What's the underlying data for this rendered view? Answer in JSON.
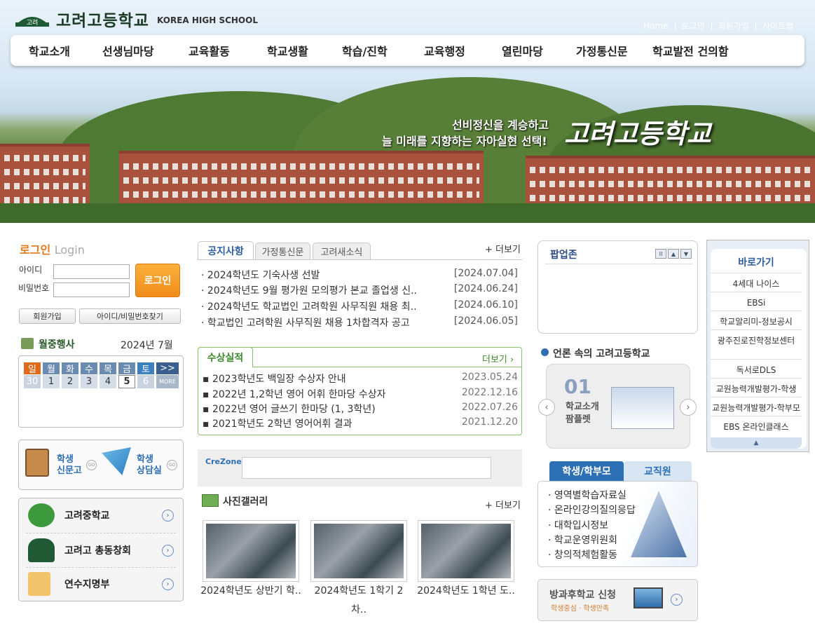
{
  "header": {
    "school_name": "고려고등학교",
    "school_name_en": "KOREA HIGH SCHOOL",
    "logo_mark": "고려",
    "util_links": [
      "Home",
      "로그인",
      "회원가입",
      "사이트맵"
    ],
    "nav": [
      "학교소개",
      "선생님마당",
      "교육활동",
      "학교생활",
      "학습/진학",
      "교육행정",
      "열린마당",
      "가정통신문",
      "학교발전 건의함"
    ],
    "slogan_line1": "선비정신을 계승하고",
    "slogan_line2": "늘 미래를 지향하는 자아실현 선택!",
    "slogan_name": "고려고등학교"
  },
  "login": {
    "title": "로그인",
    "title_en": "Login",
    "id_label": "아이디",
    "pw_label": "비밀번호",
    "button": "로그인",
    "join": "회원가입",
    "find": "아이디/비밀번호찾기"
  },
  "calendar": {
    "title": "월중행사",
    "date": "2024년 7월",
    "weekdays": [
      "일",
      "월",
      "화",
      "수",
      "목",
      "금",
      "토"
    ],
    "more": ">>",
    "more_sub": "MORE",
    "days": [
      "30",
      "1",
      "2",
      "3",
      "4",
      "5",
      "6"
    ]
  },
  "quick_left": {
    "newspaper": "학생 신문고",
    "counsel": "학생 상담실",
    "go": "GO"
  },
  "family": [
    {
      "label": "고려중학교"
    },
    {
      "label": "고려고 총동창회"
    },
    {
      "label": "연수지명부"
    }
  ],
  "notice": {
    "tabs": [
      "공지사항",
      "가정통신문",
      "고려새소식"
    ],
    "more": "+ 더보기",
    "items": [
      {
        "title": "2024학년도 기숙사생 선발",
        "date": "[2024.07.04]"
      },
      {
        "title": "2024학년도 9월 평가원 모의평가 본교 졸업생 신..",
        "date": "[2024.06.24]"
      },
      {
        "title": "2024학년도 학교법인 고려학원 사무직원 채용 최..",
        "date": "[2024.06.10]"
      },
      {
        "title": "학교법인 고려학원 사무직원 채용 1차합격자 공고",
        "date": "[2024.06.05]"
      }
    ]
  },
  "awards": {
    "tab": "수상실적",
    "more": "더보기",
    "items": [
      {
        "title": "2023학년도 백일장 수상자 안내",
        "date": "2023.05.24"
      },
      {
        "title": "2022년 1,2학년 영어 어휘 한마당 수상자",
        "date": "2022.12.16"
      },
      {
        "title": "2022년 영어 글쓰기 한마당 (1, 3학년)",
        "date": "2022.07.26"
      },
      {
        "title": "2021학년도 2학년 영어어휘 결과",
        "date": "2021.12.20"
      }
    ]
  },
  "crezone": {
    "label": "CreZone"
  },
  "gallery": {
    "title": "사진갤러리",
    "more": "+ 더보기",
    "items": [
      {
        "caption": "2024학년도 상반기 학.."
      },
      {
        "caption": "2024학년도 1학기 2차.."
      },
      {
        "caption": "2024학년도 1학년 도.."
      }
    ]
  },
  "popup": {
    "title": "팝업존"
  },
  "press": {
    "title": "언론 속의 고려고등학교",
    "num": "01",
    "text": "학교소개 팜플렛"
  },
  "student_tabs": {
    "tabs": [
      "학생/학부모",
      "교직원"
    ],
    "items": [
      "영역별학습자료실",
      "온라인강의질의응답",
      "대학입시정보",
      "학교운영위원회",
      "창의적체험활동"
    ]
  },
  "after": {
    "title": "방과후학교 신청",
    "sub": "학생중심 · 학생만족"
  },
  "quicklinks": {
    "title": "바로가기",
    "items": [
      "4세대 나이스",
      "EBSi",
      "학교알리미-정보공시",
      "광주진로진학정보센터",
      "독서로DLS",
      "교원능력개발평가-학생",
      "교원능력개발평가-학부모",
      "EBS 온라인클래스"
    ]
  },
  "colors": {
    "accent_orange": "#f08c1a",
    "award_green": "#3e8a2e",
    "nav_blue": "#2e5e9e"
  }
}
